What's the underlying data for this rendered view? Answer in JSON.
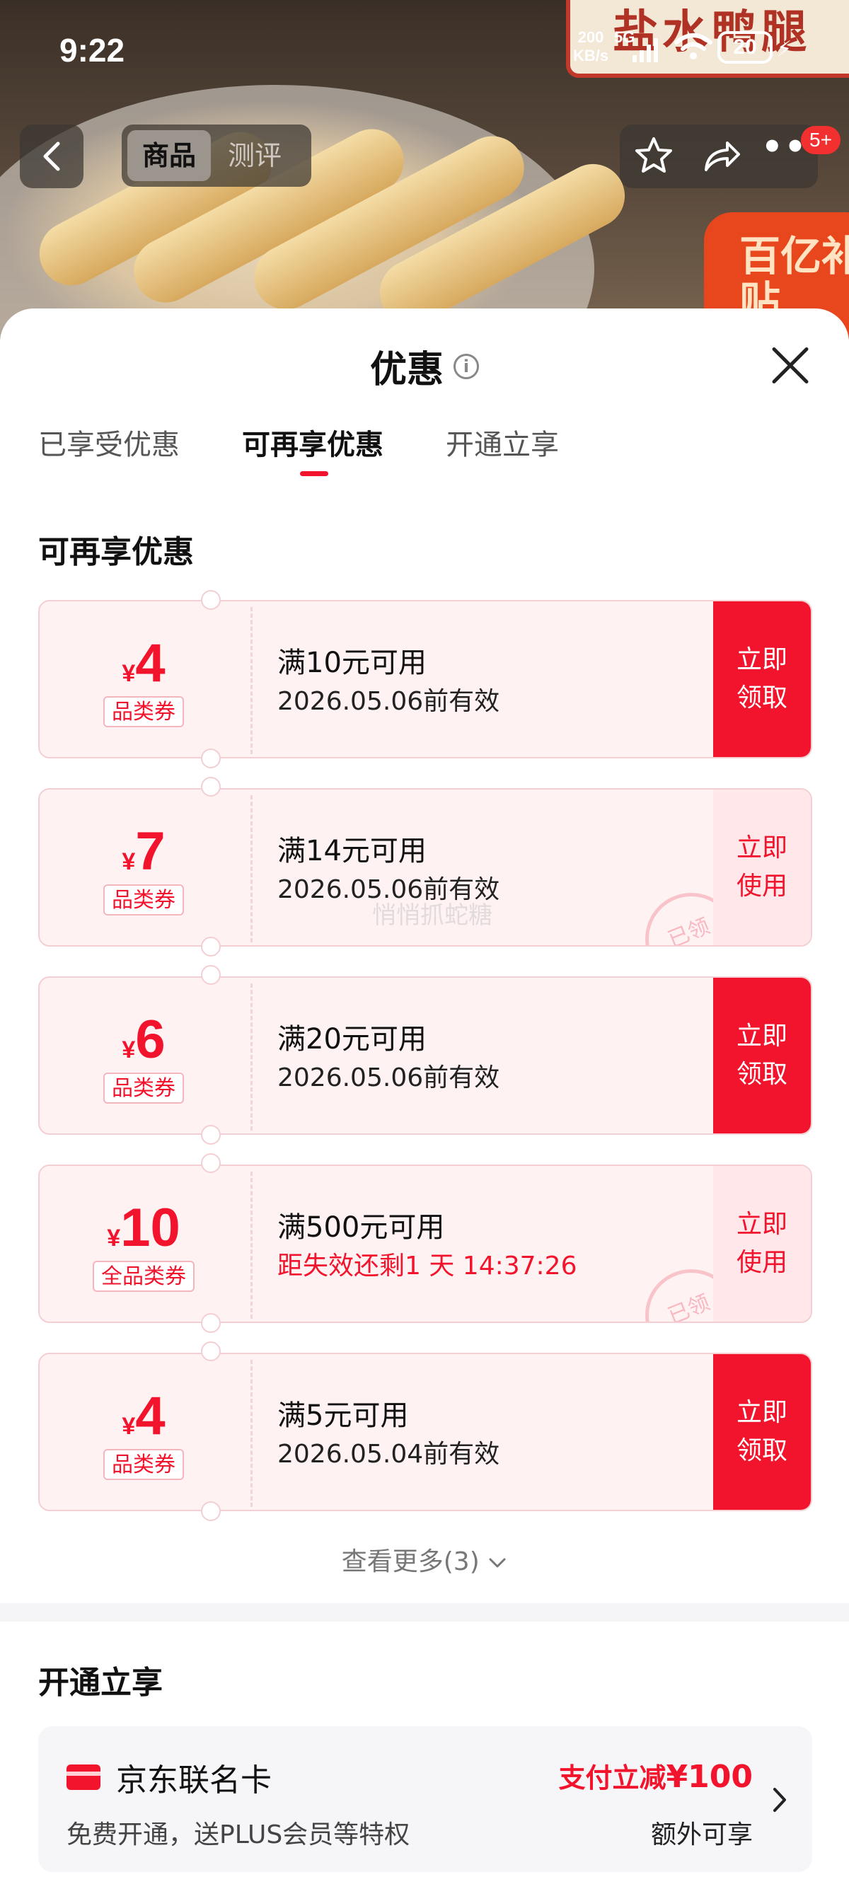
{
  "status_bar": {
    "time": "9:22",
    "speed_value": "200",
    "speed_unit": "KB/s",
    "network": "5G",
    "battery": "20"
  },
  "background": {
    "sign_text": "盐水鸭腿",
    "badge_text": "百亿补贴"
  },
  "nav": {
    "tab_goods": "商品",
    "tab_review": "测评",
    "message_badge": "5+"
  },
  "sheet": {
    "title": "优惠",
    "tabs": [
      {
        "label": "已享受优惠",
        "active": false
      },
      {
        "label": "可再享优惠",
        "active": true
      },
      {
        "label": "开通立享",
        "active": false
      }
    ],
    "section_title": "可再享优惠",
    "coupons": [
      {
        "yen": "¥",
        "amount": "4",
        "type": "品类券",
        "condition": "满10元可用",
        "validity": "2026.05.06前有效",
        "action": "立即\n领取",
        "claimed": false
      },
      {
        "yen": "¥",
        "amount": "7",
        "type": "品类券",
        "condition": "满14元可用",
        "validity": "2026.05.06前有效",
        "action": "立即\n使用",
        "claimed": true,
        "stamp": "已领"
      },
      {
        "yen": "¥",
        "amount": "6",
        "type": "品类券",
        "condition": "满20元可用",
        "validity": "2026.05.06前有效",
        "action": "立即\n领取",
        "claimed": false
      },
      {
        "yen": "¥",
        "amount": "10",
        "type": "全品类券",
        "condition": "满500元可用",
        "validity": "距失效还剩1 天 14:37:26",
        "action": "立即\n使用",
        "claimed": true,
        "stamp": "已领"
      },
      {
        "yen": "¥",
        "amount": "4",
        "type": "品类券",
        "condition": "满5元可用",
        "validity": "2026.05.04前有效",
        "action": "立即\n领取",
        "claimed": false
      }
    ],
    "watermark": "悄悄抓蛇糖",
    "view_more": "查看更多(3)",
    "open_section_title": "开通立享",
    "jd_card": {
      "name": "京东联名卡",
      "desc": "免费开通，送PLUS会员等特权",
      "offer_prefix": "支付立减",
      "offer_amount": "¥100",
      "extra": "额外可享"
    }
  },
  "colors": {
    "accent": "#f2142c",
    "coupon_bg": "#fff2f3",
    "coupon_border": "#f3cfd3"
  }
}
